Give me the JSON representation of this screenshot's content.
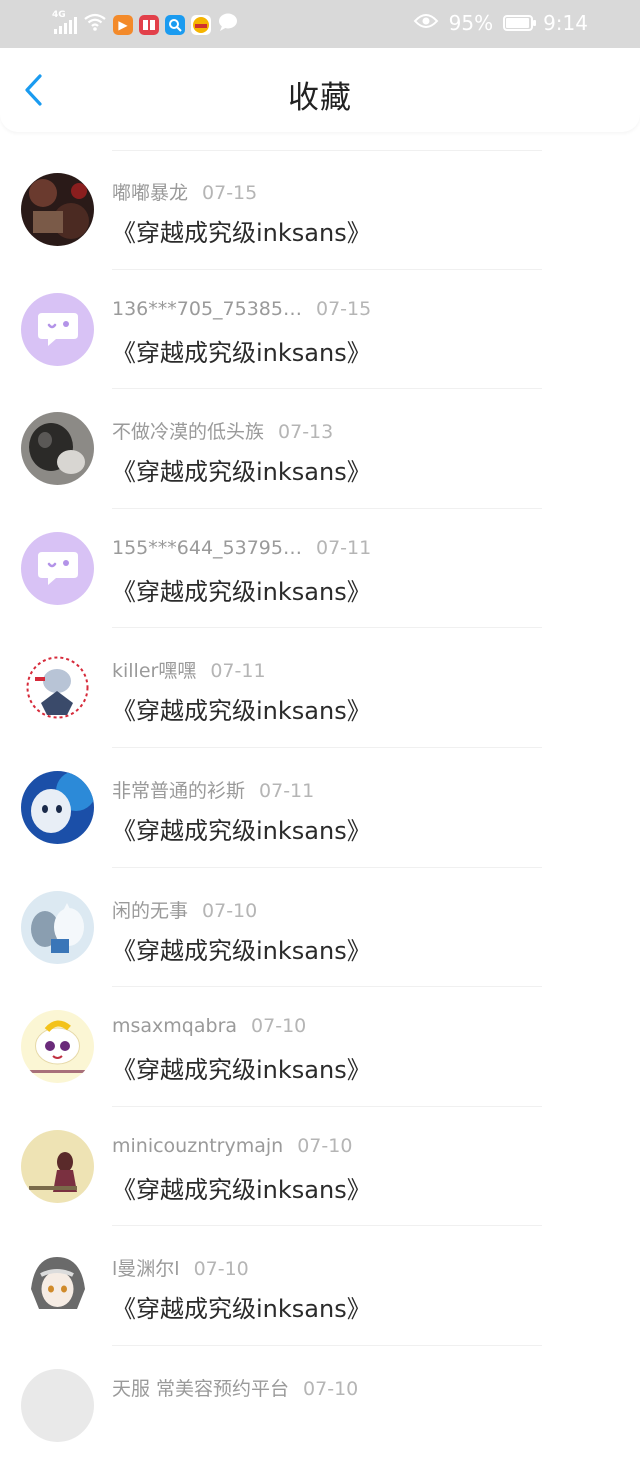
{
  "status_bar": {
    "network": "4G",
    "battery_percent": "95%",
    "battery_level": 0.95,
    "time": "9:14",
    "icons": [
      "signal-icon",
      "wifi-icon",
      "video-app-icon",
      "book-app-icon",
      "search-app-icon",
      "game-app-icon",
      "chat-bubble-icon",
      "eye-icon",
      "battery-icon"
    ]
  },
  "nav": {
    "title": "收藏",
    "back_icon": "chevron-left-icon"
  },
  "colors": {
    "accent": "#1a9bf0",
    "status_bar_bg": "#d9d9d9",
    "default_avatar": "#d8c2f5"
  },
  "items": [
    {
      "user": "嘟嘟暴龙",
      "date": "07-15",
      "book": "《穿越成究级inksans》",
      "avatar": "photo-dark-avatar"
    },
    {
      "user": "136***705_75385…",
      "date": "07-15",
      "book": "《穿越成究级inksans》",
      "avatar": "default-chat-avatar"
    },
    {
      "user": "不做冷漠的低头族",
      "date": "07-13",
      "book": "《穿越成究级inksans》",
      "avatar": "cat-photo-avatar"
    },
    {
      "user": "155***644_53795…",
      "date": "07-11",
      "book": "《穿越成究级inksans》",
      "avatar": "default-chat-avatar"
    },
    {
      "user": "killer嘿嘿",
      "date": "07-11",
      "book": "《穿越成究级inksans》",
      "avatar": "anime-red-avatar"
    },
    {
      "user": "非常普通的衫斯",
      "date": "07-11",
      "book": "《穿越成究级inksans》",
      "avatar": "anime-blue-avatar"
    },
    {
      "user": "闲的无事",
      "date": "07-10",
      "book": "《穿越成究级inksans》",
      "avatar": "anime-cats-avatar"
    },
    {
      "user": "msaxmqabra",
      "date": "07-10",
      "book": "《穿越成究级inksans》",
      "avatar": "cartoon-face-avatar"
    },
    {
      "user": "minicouzntrymajn",
      "date": "07-10",
      "book": "《穿越成究级inksans》",
      "avatar": "anime-girl-avatar"
    },
    {
      "user": "l曼渊尔l",
      "date": "07-10",
      "book": "《穿越成究级inksans》",
      "avatar": "anime-white-hair-avatar"
    },
    {
      "user": "天服 常美容预约平台",
      "date": "07-10",
      "book": "",
      "avatar": "partial-avatar"
    }
  ]
}
